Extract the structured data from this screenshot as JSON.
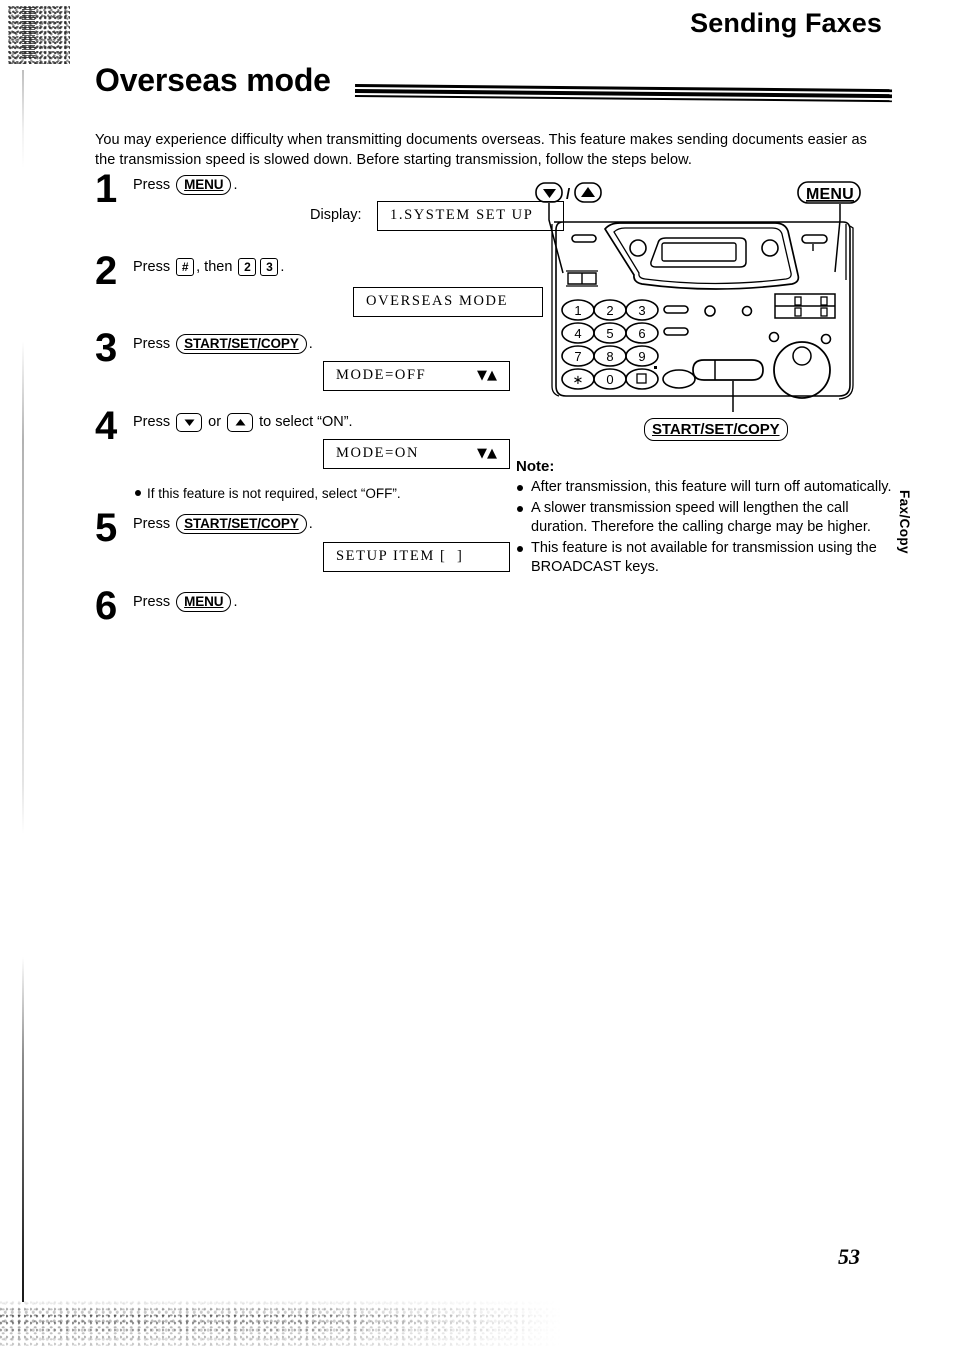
{
  "page": {
    "running_head": "Sending Faxes",
    "title": "Overseas mode",
    "page_number": "53",
    "side_tab": "Fax/Copy",
    "intro": "You may experience difficulty when transmitting documents overseas. This feature makes sending documents easier as the transmission speed is slowed down. Before starting transmission, follow the steps below."
  },
  "steps": [
    {
      "num": "1",
      "press_label": "Press",
      "key": "MENU",
      "period": ".",
      "display_label": "Display:",
      "lcd": {
        "text": "1.SYSTEM SET UP",
        "arrows": ""
      }
    },
    {
      "num": "2",
      "press_label": "Press",
      "key1": "#",
      "then_label": ", then",
      "key2": "2",
      "key3": "3",
      "period": ".",
      "lcd": {
        "text": "OVERSEAS MODE",
        "arrows": ""
      }
    },
    {
      "num": "3",
      "press_label": "Press",
      "key": "START/SET/COPY",
      "period": ".",
      "lcd": {
        "text": "MODE=OFF",
        "arrows": "▼▲"
      }
    },
    {
      "num": "4",
      "press_label": "Press",
      "key_down": "down-arrow",
      "or_label": "or",
      "key_up": "up-arrow",
      "tail_label": "to select “ON”.",
      "lcd": {
        "text": "MODE=ON",
        "arrows": "▼▲"
      },
      "note": "If this feature is not required, select “OFF”."
    },
    {
      "num": "5",
      "press_label": "Press",
      "key": "START/SET/COPY",
      "period": ".",
      "lcd": {
        "text": "SETUP ITEM [  ]",
        "arrows": ""
      }
    },
    {
      "num": "6",
      "press_label": "Press",
      "key": "MENU",
      "period": "."
    }
  ],
  "machine": {
    "callout_arrows": "▼ / ▲",
    "callout_arrows_down": "▼",
    "callout_arrows_sep": "/",
    "callout_arrows_up": "▲",
    "callout_menu": "MENU",
    "callout_start": "START/SET/COPY",
    "keypad": [
      "1",
      "2",
      "3",
      "4",
      "5",
      "6",
      "7",
      "8",
      "9",
      "∗",
      "0",
      "#"
    ]
  },
  "note": {
    "title": "Note:",
    "items": [
      "After transmission, this feature will turn off automatically.",
      "A slower transmission speed will lengthen the call duration. Therefore the calling charge may be higher.",
      "This feature is not available for transmission using the BROADCAST keys."
    ]
  }
}
